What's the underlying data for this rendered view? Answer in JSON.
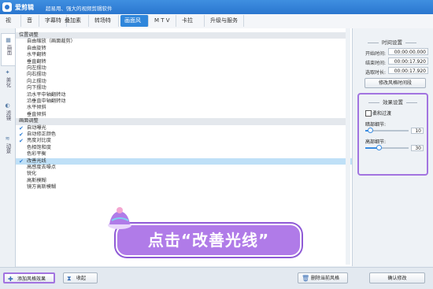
{
  "app": {
    "name": "爱剪辑",
    "slogan": "超易用、强大的视频剪辑软件"
  },
  "menu": [
    {
      "label": "视  频",
      "active": false
    },
    {
      "label": "音  频",
      "active": false
    },
    {
      "label": "字幕特效",
      "active": false
    },
    {
      "label": "叠加素材",
      "active": false
    },
    {
      "label": "转场特效",
      "active": false
    },
    {
      "label": "画面风格",
      "active": true
    },
    {
      "label": "M T V",
      "active": false
    },
    {
      "label": "卡拉OK",
      "active": false
    },
    {
      "label": "升级与服务",
      "active": false
    }
  ],
  "side_tabs": [
    {
      "label": "画面",
      "icon": "frame-icon"
    },
    {
      "label": "美化",
      "icon": "wand-icon"
    },
    {
      "label": "滤镜",
      "icon": "filter-icon"
    },
    {
      "label": "动景",
      "icon": "wave-icon"
    }
  ],
  "list": {
    "groups": [
      {
        "title": "位置调整",
        "items": [
          {
            "label": "自由缩放（画面裁剪）"
          },
          {
            "label": "自由旋转"
          },
          {
            "label": "水平翻转"
          },
          {
            "label": "垂直翻转"
          },
          {
            "label": "向左摆动"
          },
          {
            "label": "向右摆动"
          },
          {
            "label": "向上摆动"
          },
          {
            "label": "向下摆动"
          },
          {
            "label": "沿水平中轴翻转动"
          },
          {
            "label": "沿垂直中轴翻转动"
          },
          {
            "label": "水平倾斜"
          },
          {
            "label": "垂直倾斜"
          }
        ]
      },
      {
        "title": "画面调整",
        "items": [
          {
            "label": "自动曝光",
            "checked": true
          },
          {
            "label": "自动修正颜色",
            "checked": true
          },
          {
            "label": "亮度对比度",
            "checked": true
          },
          {
            "label": "色相饱和度"
          },
          {
            "label": "色彩平衡"
          },
          {
            "label": "改善光线",
            "checked": true,
            "selected": true
          },
          {
            "label": "高感度去噪点"
          },
          {
            "label": "锐化"
          },
          {
            "label": "高斯模糊"
          },
          {
            "label": "镜方高斯模糊"
          }
        ]
      }
    ]
  },
  "time_settings": {
    "title": "时间设置",
    "start_label": "开始时间:",
    "start_value": "00:00:00.000",
    "end_label": "结束时间:",
    "end_value": "00:00:17.920",
    "duration_label": "选取时长:",
    "duration_value": "00:00:17.920",
    "modify_button": "修改风格时间段"
  },
  "effect_settings": {
    "title": "效果设置",
    "soft_transition_label": "柔和过渡",
    "dark_label": "暗部细节:",
    "dark_value": "10",
    "dark_level": 0.1,
    "bright_label": "高部细节:",
    "bright_value": "30",
    "bright_level": 0.3
  },
  "buttons": {
    "add_style": "添加风格效果",
    "collapse": "收起",
    "delete_style": "删除当前风格",
    "confirm": "确认修改"
  },
  "overlay": {
    "text": "点击“改善光线”"
  },
  "colors": {
    "accent": "#2f86db",
    "highlight": "#a274e0",
    "selected_row": "#bfe0f7"
  }
}
